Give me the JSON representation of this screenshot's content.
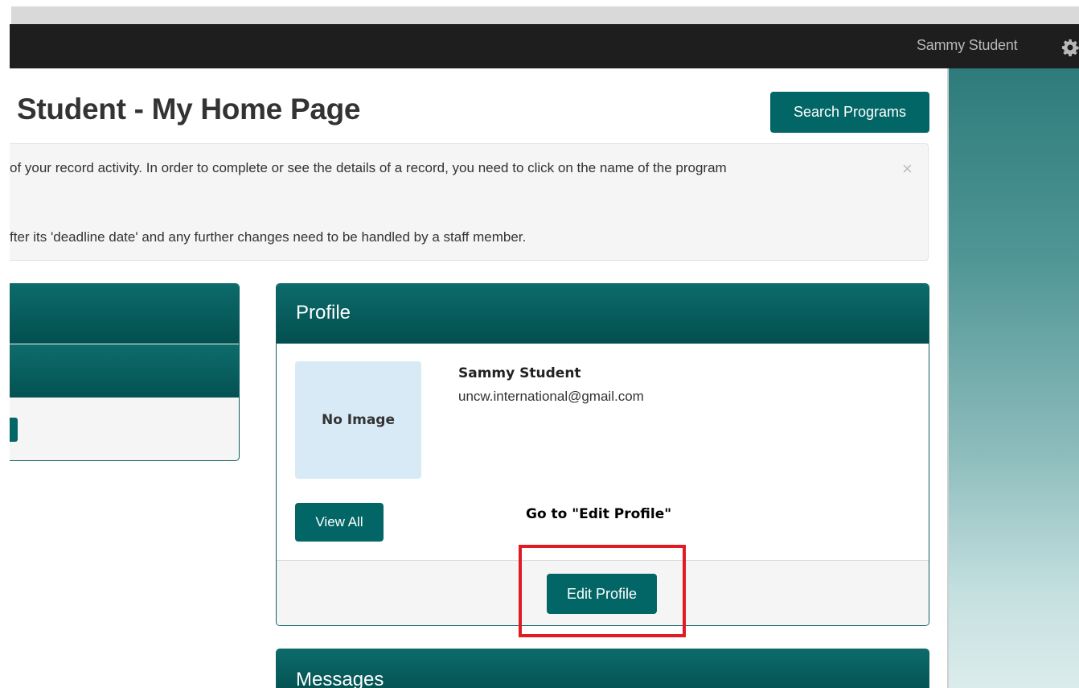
{
  "navbar": {
    "user_name": "Sammy Student",
    "settings_icon": "gear-icon"
  },
  "header": {
    "page_title": "Student - My Home Page",
    "search_button_label": "Search Programs"
  },
  "alert": {
    "line1": "of your record activity. In order to complete or see the details of a record, you need to click on the name of the program",
    "line2": "fter its 'deadline date' and any further changes need to be handled by a staff member.",
    "close_glyph": "×"
  },
  "profile": {
    "title": "Profile",
    "image_placeholder": "No Image",
    "name": "Sammy Student",
    "email": "uncw.international@gmail.com",
    "view_all_label": "View All",
    "edit_profile_label": "Edit Profile"
  },
  "annotation": {
    "instruction": "Go to \"Edit Profile\"",
    "highlight_color": "#e01b24"
  },
  "messages": {
    "title": "Messages"
  },
  "colors": {
    "brand_teal": "#036666",
    "navbar": "#1e1e1e"
  }
}
